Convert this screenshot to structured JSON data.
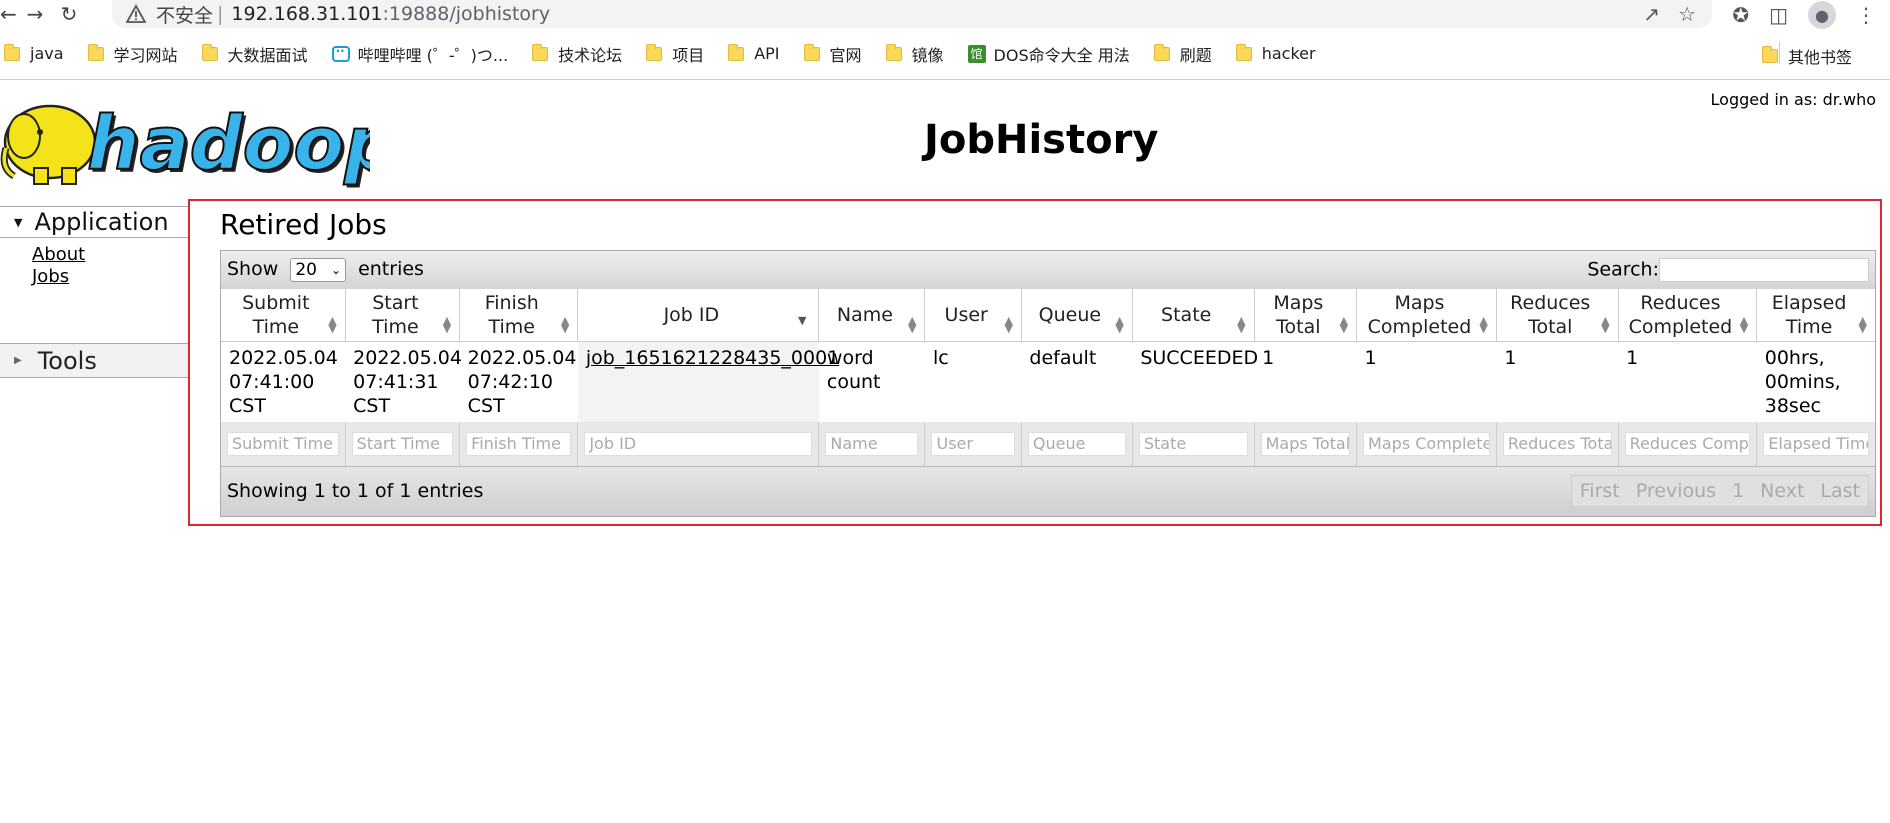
{
  "browser": {
    "insecure_label": "不安全",
    "separator": "|",
    "url_host": "192.168.31.101",
    "url_path": ":19888/jobhistory",
    "bookmarks": [
      {
        "label": "java",
        "icon": "folder-icon"
      },
      {
        "label": "学习网站",
        "icon": "folder-icon"
      },
      {
        "label": "大数据面试",
        "icon": "folder-icon"
      },
      {
        "label": "哔哩哔哩 (゜-゜)つ...",
        "icon": "bilibili-icon"
      },
      {
        "label": "技术论坛",
        "icon": "folder-icon"
      },
      {
        "label": "项目",
        "icon": "folder-icon"
      },
      {
        "label": "API",
        "icon": "folder-icon"
      },
      {
        "label": "官网",
        "icon": "folder-icon"
      },
      {
        "label": "镜像",
        "icon": "folder-icon"
      },
      {
        "label": "DOS命令大全 用法",
        "icon": "dos-icon"
      },
      {
        "label": "刷题",
        "icon": "folder-icon"
      },
      {
        "label": "hacker",
        "icon": "folder-icon"
      }
    ],
    "other_bookmarks": "其他书签",
    "dos_icon_glyph": "馆"
  },
  "header": {
    "logged_in": "Logged in as: dr.who",
    "title": "JobHistory",
    "logo_text": "hadoop"
  },
  "sidebar": {
    "application": "Application",
    "links": [
      "About",
      "Jobs"
    ],
    "tools": "Tools"
  },
  "content": {
    "title": "Retired Jobs",
    "show_label": "Show",
    "show_value": "20",
    "entries_label": "entries",
    "search_label": "Search:",
    "columns": [
      "Submit Time",
      "Start Time",
      "Finish Time",
      "Job ID",
      "Name",
      "User",
      "Queue",
      "State",
      "Maps Total",
      "Maps Completed",
      "Reduces Total",
      "Reduces Completed",
      "Elapsed Time"
    ],
    "rows": [
      [
        "2022.05.04 07:41:00 CST",
        "2022.05.04 07:41:31 CST",
        "2022.05.04 07:42:10 CST",
        "job_1651621228435_0001",
        "word count",
        "lc",
        "default",
        "SUCCEEDED",
        "1",
        "1",
        "1",
        "1",
        "00hrs, 00mins, 38sec"
      ]
    ],
    "filter_placeholders": [
      "Submit Time",
      "Start Time",
      "Finish Time",
      "Job ID",
      "Name",
      "User",
      "Queue",
      "State",
      "Maps Total",
      "Maps Completed",
      "Reduces Total",
      "Reduces Completed",
      "Elapsed Time"
    ],
    "info": "Showing 1 to 1 of 1 entries",
    "pager": [
      "First",
      "Previous",
      "1",
      "Next",
      "Last"
    ]
  },
  "colors": {
    "highlight_border": "#e0262f",
    "elephant_yellow": "#f5e31a",
    "logo_blue": "#39b4ea"
  }
}
